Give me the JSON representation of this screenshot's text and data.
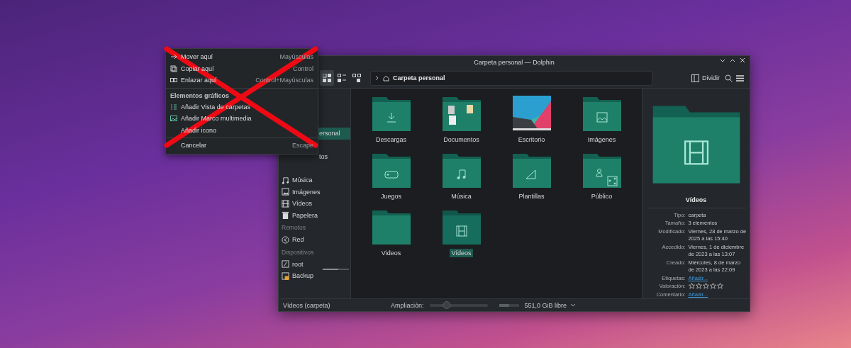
{
  "window": {
    "title": "Carpeta personal — Dolphin"
  },
  "toolbar": {
    "view_modes": [
      {
        "kind": "icons",
        "selected": true
      },
      {
        "kind": "details",
        "selected": false
      },
      {
        "kind": "compact",
        "selected": false
      }
    ],
    "breadcrumb": "Carpeta personal",
    "split_button": "Dividir"
  },
  "sidebar": {
    "sections": [
      {
        "items": [
          {
            "kind": "partial",
            "label": "ersonal",
            "selected": true
          },
          {
            "kind": "partial",
            "label": "tos",
            "selected": false
          },
          {
            "kind": "music",
            "label": "Música",
            "selected": false
          },
          {
            "kind": "pictures",
            "label": "Imágenes",
            "selected": false
          },
          {
            "kind": "videos",
            "label": "Vídeos",
            "selected": false
          },
          {
            "kind": "trash",
            "label": "Papelera",
            "selected": false
          }
        ]
      },
      {
        "heading": "Remotos",
        "items": [
          {
            "kind": "network",
            "label": "Red",
            "selected": false
          }
        ]
      },
      {
        "heading": "Dispositivos",
        "items": [
          {
            "kind": "drive",
            "label": "root",
            "selected": false,
            "level": 0.6
          },
          {
            "kind": "backup",
            "label": "Backup",
            "selected": false
          }
        ]
      }
    ]
  },
  "files": [
    {
      "kind": "downloads",
      "name": "Descargas",
      "selected": false
    },
    {
      "kind": "documents",
      "name": "Documentos",
      "selected": false
    },
    {
      "kind": "desktop",
      "name": "Escritorio",
      "selected": false
    },
    {
      "kind": "pictures",
      "name": "Imágenes",
      "selected": false
    },
    {
      "kind": "games",
      "name": "Juegos",
      "selected": false
    },
    {
      "kind": "music",
      "name": "Música",
      "selected": false
    },
    {
      "kind": "templates",
      "name": "Plantillas",
      "selected": false
    },
    {
      "kind": "public",
      "name": "Público",
      "selected": false
    },
    {
      "kind": "plain",
      "name": "Videos",
      "selected": false
    },
    {
      "kind": "videos",
      "name": "Vídeos",
      "selected": true
    }
  ],
  "info_panel": {
    "title": "Vídeos",
    "properties": [
      {
        "kind": "text",
        "label": "Tipo:",
        "value": "carpeta"
      },
      {
        "kind": "text",
        "label": "Tamaño:",
        "value": "3 elementos"
      },
      {
        "kind": "text",
        "label": "Modificado:",
        "value": "Viernes, 28 de marzo de 2025 a las 15:40"
      },
      {
        "kind": "text",
        "label": "Accedido:",
        "value": "Viernes, 1 de diciembre de 2023 a las 13:07"
      },
      {
        "kind": "text",
        "label": "Creado:",
        "value": "Miércoles, 8 de marzo de 2023 a las 22:09"
      },
      {
        "kind": "link",
        "label": "Etiquetas:",
        "value": "Añadir..."
      },
      {
        "kind": "rating",
        "label": "Valoración:",
        "stars": 0
      },
      {
        "kind": "link",
        "label": "Comentario:",
        "value": "Añadir..."
      }
    ]
  },
  "status_bar": {
    "text": "Vídeos (carpeta)",
    "zoom_label": "Ampliación:",
    "zoom": {
      "level": 0.3
    },
    "disk": {
      "level": 0.5
    },
    "free_space": "551,0 GiB libre"
  },
  "context_menu": {
    "crossed_out": true,
    "items": [
      {
        "kind": "move",
        "label": "Mover aquí",
        "shortcut": "Mayúsculas"
      },
      {
        "kind": "copy",
        "label": "Copiar aquí",
        "shortcut": "Control"
      },
      {
        "kind": "link",
        "label": "Enlazar aquí",
        "shortcut": "Control+Mayúsculas"
      },
      {
        "kind": "separator"
      },
      {
        "kind": "heading",
        "label": "Elementos gráficos"
      },
      {
        "kind": "folderview",
        "label": "Añadir Vista de carpetas"
      },
      {
        "kind": "mediaframe",
        "label": "Añadir Marco multimedia"
      },
      {
        "kind": "plain",
        "label": "Añadir icono"
      },
      {
        "kind": "separator"
      },
      {
        "kind": "plain",
        "label": "Cancelar",
        "shortcut": "Escape"
      }
    ]
  }
}
